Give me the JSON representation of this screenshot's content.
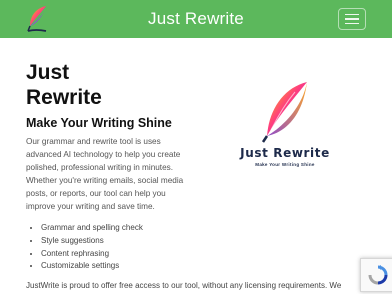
{
  "header": {
    "title": "Just Rewrite",
    "logo_icon": "quill-feather-icon",
    "menu_icon": "hamburger-icon"
  },
  "main": {
    "heading": "Just\nRewrite",
    "subheading": "Make Your Writing Shine",
    "intro": "Our grammar and rewrite tool is uses advanced AI technology to help you create polished, professional writing in minutes. Whether you're writing emails, social media posts, or reports, our tool can help you improve your writing and save time.",
    "features": [
      "Grammar and spelling check",
      "Style suggestions",
      "Content rephrasing",
      "Customizable settings"
    ],
    "footer_text": "JustWrite is proud to offer free access to our tool, without any licensing requirements. We"
  },
  "brand_logo": {
    "name": "Just Rewrite",
    "tagline": "Make Your Writing Shine",
    "icon": "quill-feather-icon"
  },
  "colors": {
    "header_bg": "#5cb85c",
    "brand_navy": "#1d2a4a",
    "feather_gradient": [
      "#ffcc00",
      "#ff3d7f",
      "#8a2be2"
    ]
  },
  "recaptcha_icon": "recaptcha-icon"
}
